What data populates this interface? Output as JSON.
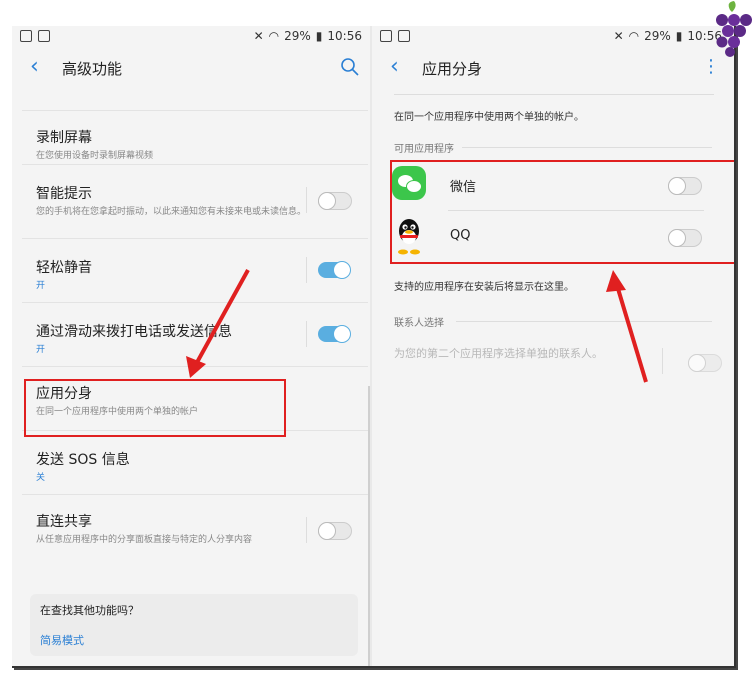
{
  "status_bar": {
    "battery": "29%",
    "time": "10:56"
  },
  "left": {
    "title": "高级功能",
    "items": [
      {
        "title": "录制屏幕",
        "subtitle": "在您使用设备时录制屏幕视频"
      },
      {
        "title": "智能提示",
        "subtitle": "您的手机将在您拿起时振动，以此来通知您有未接来电或未读信息。",
        "toggle": "off"
      },
      {
        "title": "轻松静音",
        "subtitle": "开",
        "toggle": "on"
      },
      {
        "title": "通过滑动来拨打电话或发送信息",
        "subtitle": "开",
        "toggle": "on"
      },
      {
        "title": "应用分身",
        "subtitle": "在同一个应用程序中使用两个单独的帐户"
      },
      {
        "title": "发送 SOS 信息",
        "subtitle": "关"
      },
      {
        "title": "直连共享",
        "subtitle": "从任意应用程序中的分享面板直接与特定的人分享内容",
        "toggle": "off"
      }
    ],
    "card": {
      "question": "在查找其他功能吗？",
      "link": "简易模式"
    }
  },
  "right": {
    "title": "应用分身",
    "description": "在同一个应用程序中使用两个单独的帐户。",
    "available_section": "可用应用程序",
    "apps": [
      {
        "name": "微信",
        "icon": "wechat-icon",
        "toggle": "off"
      },
      {
        "name": "QQ",
        "icon": "qq-icon",
        "toggle": "off"
      }
    ],
    "support_text": "支持的应用程序在安装后将显示在这里。",
    "contacts_section": "联系人选择",
    "contacts_text": "为您的第二个应用程序选择单独的联系人。",
    "contacts_toggle": "off"
  },
  "colors": {
    "accent": "#2a7fd4",
    "highlight": "#e02020",
    "toggle_on": "#5aaee0"
  }
}
